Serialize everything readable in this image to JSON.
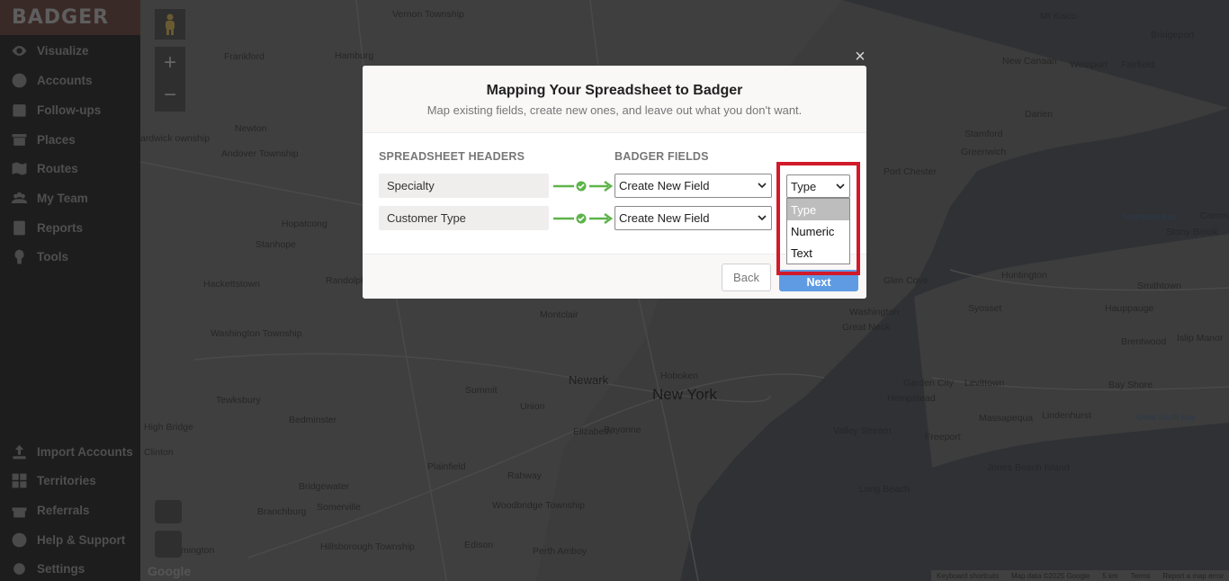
{
  "brand": "BADGER",
  "sidebar": {
    "items": [
      {
        "label": "Visualize",
        "icon": "eye-icon"
      },
      {
        "label": "Accounts",
        "icon": "user-icon"
      },
      {
        "label": "Follow-ups",
        "icon": "calendar-icon"
      },
      {
        "label": "Places",
        "icon": "store-icon"
      },
      {
        "label": "Routes",
        "icon": "map-icon"
      },
      {
        "label": "My Team",
        "icon": "team-icon"
      },
      {
        "label": "Reports",
        "icon": "report-icon"
      },
      {
        "label": "Tools",
        "icon": "wrench-icon"
      }
    ],
    "bottom_items": [
      {
        "label": "Import Accounts",
        "icon": "upload-icon"
      },
      {
        "label": "Territories",
        "icon": "grid-icon"
      },
      {
        "label": "Referrals",
        "icon": "gift-icon"
      },
      {
        "label": "Help & Support",
        "icon": "help-icon"
      },
      {
        "label": "Settings",
        "icon": "gear-icon"
      }
    ]
  },
  "map": {
    "labels": [
      "Vernon Township",
      "Frankford",
      "Hamburg",
      "New City",
      "Ossining",
      "Mt Kisco",
      "Bridgeport",
      "New Canaan",
      "Westport",
      "Fairfield",
      "Darien",
      "Stamford",
      "Port Chester",
      "Greenwich",
      "Newton",
      "Andover Township",
      "ardwick ownship",
      "Hopatcong",
      "Stanhope",
      "Randolph",
      "Hackettstown",
      "Washington Township",
      "Montclair",
      "Newark",
      "New York",
      "Hoboken",
      "Summit",
      "Union",
      "Elizabeth",
      "Bayonne",
      "Tewksbury",
      "Bedminster",
      "High Bridge",
      "Clinton",
      "Plainfield",
      "Rahway",
      "Bridgewater",
      "Somerville",
      "Branchburg",
      "Woodbridge Township",
      "Hillsborough Township",
      "Edison",
      "Perth Amboy",
      "mington",
      "Glen Cove",
      "Huntington",
      "Smithtown",
      "Stony Brook",
      "Great Neck",
      "Syosset",
      "Hauppauge",
      "Brentwood",
      "Garden City",
      "Hempstead",
      "Levittown",
      "Bay Shore",
      "Valley Stream",
      "Freeport",
      "Massapequa",
      "Lindenhurst",
      "Jones Beach Island",
      "Long Beach",
      "Washington",
      "Great South Bay",
      "Smithtown Bay",
      "Islip Manor",
      "Commack"
    ],
    "footer": [
      "Keyboard shortcuts",
      "Map data ©2025 Google",
      "5 km",
      "Terms",
      "Report a map error"
    ],
    "google_logo": "Google"
  },
  "modal": {
    "title": "Mapping Your Spreadsheet to Badger",
    "subtitle": "Map existing fields, create new ones, and leave out what you don't want.",
    "col_spreadsheet": "SPREADSHEET HEADERS",
    "col_badger": "BADGER FIELDS",
    "rows": [
      {
        "header": "Specialty",
        "field": "Create New Field",
        "type": "Type"
      },
      {
        "header": "Customer Type",
        "field": "Create New Field",
        "type": ""
      }
    ],
    "type_options": [
      "Type",
      "Numeric",
      "Text"
    ],
    "back_label": "Back",
    "next_label": "Next",
    "close_label": "×"
  },
  "colors": {
    "accent_green": "#5db44a",
    "highlight_red": "#d11a2a",
    "next_blue": "#5f9be3"
  }
}
